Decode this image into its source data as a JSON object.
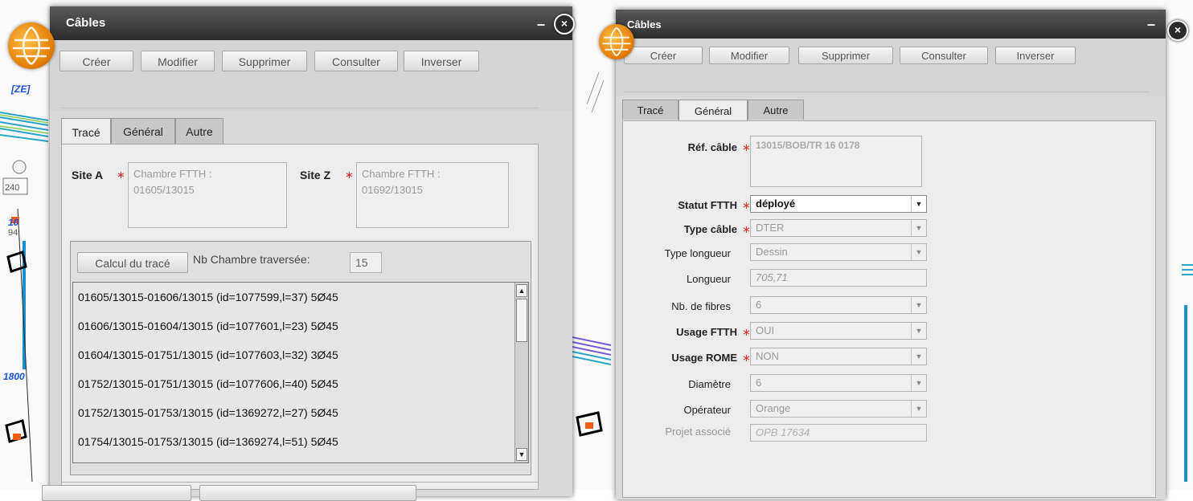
{
  "map": {
    "labels": [
      "[ZE]",
      "240",
      "10",
      "94",
      "1800"
    ]
  },
  "left_panel": {
    "title": "Câbles",
    "toolbar": [
      "Créer",
      "Modifier",
      "Supprimer",
      "Consulter",
      "Inverser"
    ],
    "tabs": [
      "Tracé",
      "Général",
      "Autre"
    ],
    "active_tab": "Tracé",
    "site_a": {
      "label": "Site A",
      "value": "Chambre FTTH :\n01605/13015"
    },
    "site_z": {
      "label": "Site Z",
      "value": "Chambre FTTH :\n01692/13015"
    },
    "calc_button": "Calcul du tracé",
    "nb_label": "Nb Chambre traversée:",
    "nb_value": "15",
    "route_items": [
      "01605/13015-01606/13015 (id=1077599,l=37) 5Ø45",
      "01606/13015-01604/13015 (id=1077601,l=23) 5Ø45",
      "01604/13015-01751/13015 (id=1077603,l=32) 3Ø45",
      "01752/13015-01751/13015 (id=1077606,l=40) 5Ø45",
      "01752/13015-01753/13015 (id=1369272,l=27) 5Ø45",
      "01754/13015-01753/13015 (id=1369274,l=51) 5Ø45"
    ]
  },
  "right_panel": {
    "title": "Câbles",
    "toolbar": [
      "Créer",
      "Modifier",
      "Supprimer",
      "Consulter",
      "Inverser"
    ],
    "tabs": [
      "Tracé",
      "Général",
      "Autre"
    ],
    "active_tab": "Général",
    "fields": {
      "ref_cable": {
        "label": "Réf. câble",
        "value": "13015/BOB/TR 16 0178"
      },
      "statut_ftth": {
        "label": "Statut FTTH",
        "value": "déployé"
      },
      "type_cable": {
        "label": "Type câble",
        "value": "DTER"
      },
      "type_longueur": {
        "label": "Type longueur",
        "value": "Dessin"
      },
      "longueur": {
        "label": "Longueur",
        "value": "705,71"
      },
      "nb_fibres": {
        "label": "Nb. de fibres",
        "value": "6"
      },
      "usage_ftth": {
        "label": "Usage FTTH",
        "value": "OUI"
      },
      "usage_rome": {
        "label": "Usage ROME",
        "value": "NON"
      },
      "diametre": {
        "label": "Diamètre",
        "value": "6"
      },
      "operateur": {
        "label": "Opérateur",
        "value": "Orange"
      },
      "projet_associe": {
        "label": "Projet associé",
        "value": "OPB 17634"
      }
    }
  }
}
